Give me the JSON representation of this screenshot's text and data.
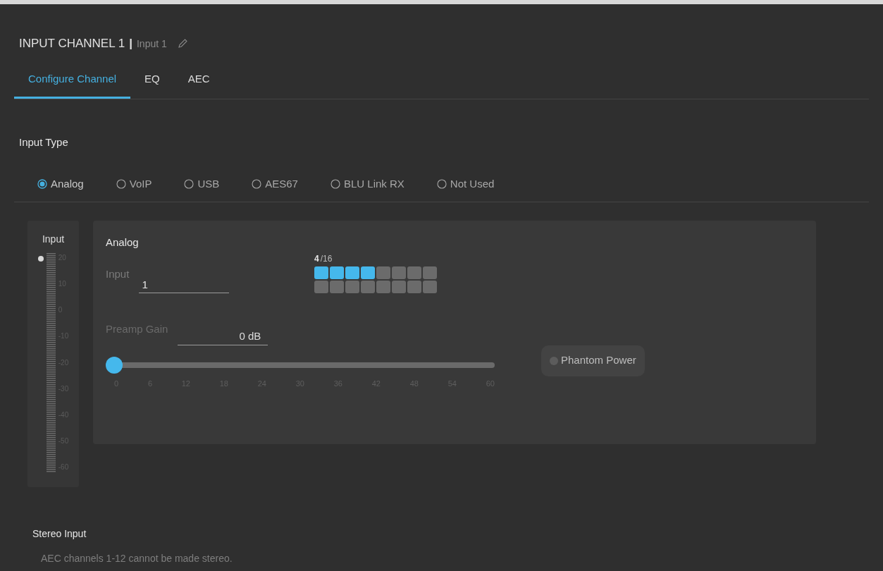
{
  "header": {
    "title": "INPUT CHANNEL 1",
    "separator": "|",
    "name": "Input 1"
  },
  "tabs": [
    {
      "label": "Configure Channel",
      "selected": true
    },
    {
      "label": "EQ",
      "selected": false
    },
    {
      "label": "AEC",
      "selected": false
    }
  ],
  "input_type": {
    "heading": "Input Type",
    "options": [
      {
        "label": "Analog",
        "selected": true
      },
      {
        "label": "VoIP",
        "selected": false
      },
      {
        "label": "USB",
        "selected": false
      },
      {
        "label": "AES67",
        "selected": false
      },
      {
        "label": "BLU Link RX",
        "selected": false
      },
      {
        "label": "Not Used",
        "selected": false
      }
    ]
  },
  "meter": {
    "label": "Input",
    "scale": [
      "20",
      "10",
      "0",
      "-10",
      "-20",
      "-30",
      "-40",
      "-50",
      "-60"
    ]
  },
  "analog": {
    "heading": "Analog",
    "input_label": "Input",
    "input_value": "1",
    "count": "4",
    "total": "/16",
    "slots": [
      {
        "on": true
      },
      {
        "on": true
      },
      {
        "on": true
      },
      {
        "on": true
      },
      {
        "on": false
      },
      {
        "on": false
      },
      {
        "on": false
      },
      {
        "on": false
      },
      {
        "on": false
      },
      {
        "on": false
      },
      {
        "on": false
      },
      {
        "on": false
      },
      {
        "on": false
      },
      {
        "on": false
      },
      {
        "on": false
      },
      {
        "on": false
      }
    ],
    "gain_label": "Preamp Gain",
    "gain_value": "0 dB",
    "slider": {
      "level": 0,
      "ticks": [
        "0",
        "6",
        "12",
        "18",
        "24",
        "30",
        "36",
        "42",
        "48",
        "54",
        "60"
      ]
    },
    "phantom": {
      "label": "Phantom Power",
      "on": false
    }
  },
  "stereo": {
    "heading": "Stereo Input",
    "note": "AEC channels 1-12 cannot be made stereo."
  }
}
